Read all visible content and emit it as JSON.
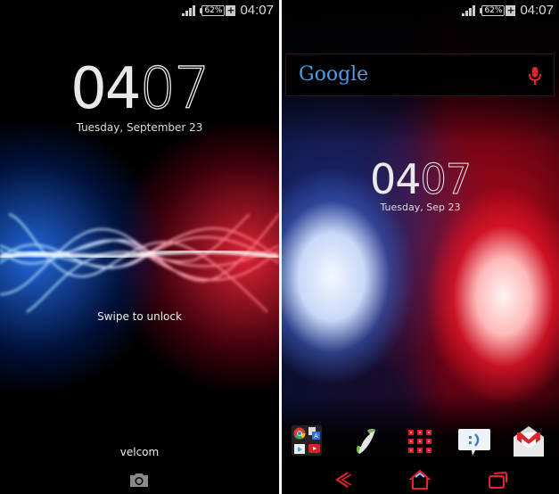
{
  "lock_screen": {
    "status_bar": {
      "battery": "62%",
      "time": "04:07",
      "icons": [
        "signal-icon",
        "battery-icon",
        "charging-icon"
      ]
    },
    "clock": {
      "hours": "04",
      "minutes": "07"
    },
    "date": "Tuesday, September 23",
    "swipe_hint": "Swipe to unlock",
    "carrier": "velcom",
    "camera_icon": "camera-icon"
  },
  "home_screen": {
    "status_bar": {
      "battery": "62%",
      "time": "04:07",
      "icons": [
        "signal-icon",
        "battery-icon",
        "charging-icon"
      ]
    },
    "search": {
      "logo": "Google",
      "mic_icon": "mic-icon"
    },
    "clock": {
      "hours": "04",
      "minutes": "07"
    },
    "date": "Tuesday, Sep 23",
    "dock": [
      {
        "name": "folder",
        "apps": [
          "Chrome",
          "Translate",
          "Play Store",
          "YouTube"
        ]
      },
      {
        "name": "Phone"
      },
      {
        "name": "Apps drawer"
      },
      {
        "name": "Messaging"
      },
      {
        "name": "Gmail"
      }
    ],
    "nav": [
      "back-icon",
      "home-icon",
      "recents-icon"
    ],
    "colors": {
      "accent": "#e8202e",
      "google_blue": "#4a9de8"
    }
  }
}
